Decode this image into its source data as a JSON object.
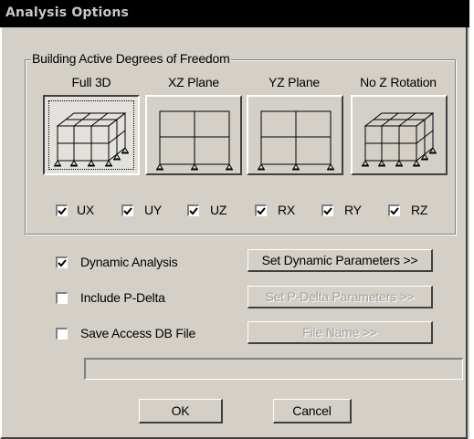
{
  "window": {
    "title": "Analysis Options"
  },
  "dof_group": {
    "label": "Building Active Degrees of Freedom",
    "options": [
      {
        "label": "Full 3D",
        "icon": "3d-frame-icon",
        "selected": true
      },
      {
        "label": "XZ Plane",
        "icon": "xz-plane-frame-icon",
        "selected": false
      },
      {
        "label": "YZ Plane",
        "icon": "yz-plane-frame-icon",
        "selected": false
      },
      {
        "label": "No Z Rotation",
        "icon": "no-z-rotation-frame-icon",
        "selected": false
      }
    ],
    "dofs": [
      {
        "label": "UX",
        "checked": true
      },
      {
        "label": "UY",
        "checked": true
      },
      {
        "label": "UZ",
        "checked": true
      },
      {
        "label": "RX",
        "checked": true
      },
      {
        "label": "RY",
        "checked": true
      },
      {
        "label": "RZ",
        "checked": true
      }
    ]
  },
  "options": {
    "dynamic": {
      "label": "Dynamic Analysis",
      "checked": true,
      "button": "Set Dynamic Parameters >>",
      "button_enabled": true
    },
    "pdelta": {
      "label": "Include P-Delta",
      "checked": false,
      "button": "Set P-Delta Parameters >>",
      "button_enabled": false
    },
    "access": {
      "label": "Save Access DB File",
      "checked": false,
      "button": "File Name >>",
      "button_enabled": false
    }
  },
  "file_path": {
    "value": ""
  },
  "footer": {
    "ok": "OK",
    "cancel": "Cancel"
  },
  "colors": {
    "face": "#d4d0c8",
    "titlebar": "#000000",
    "disabled_text": "#a0a0a0"
  }
}
